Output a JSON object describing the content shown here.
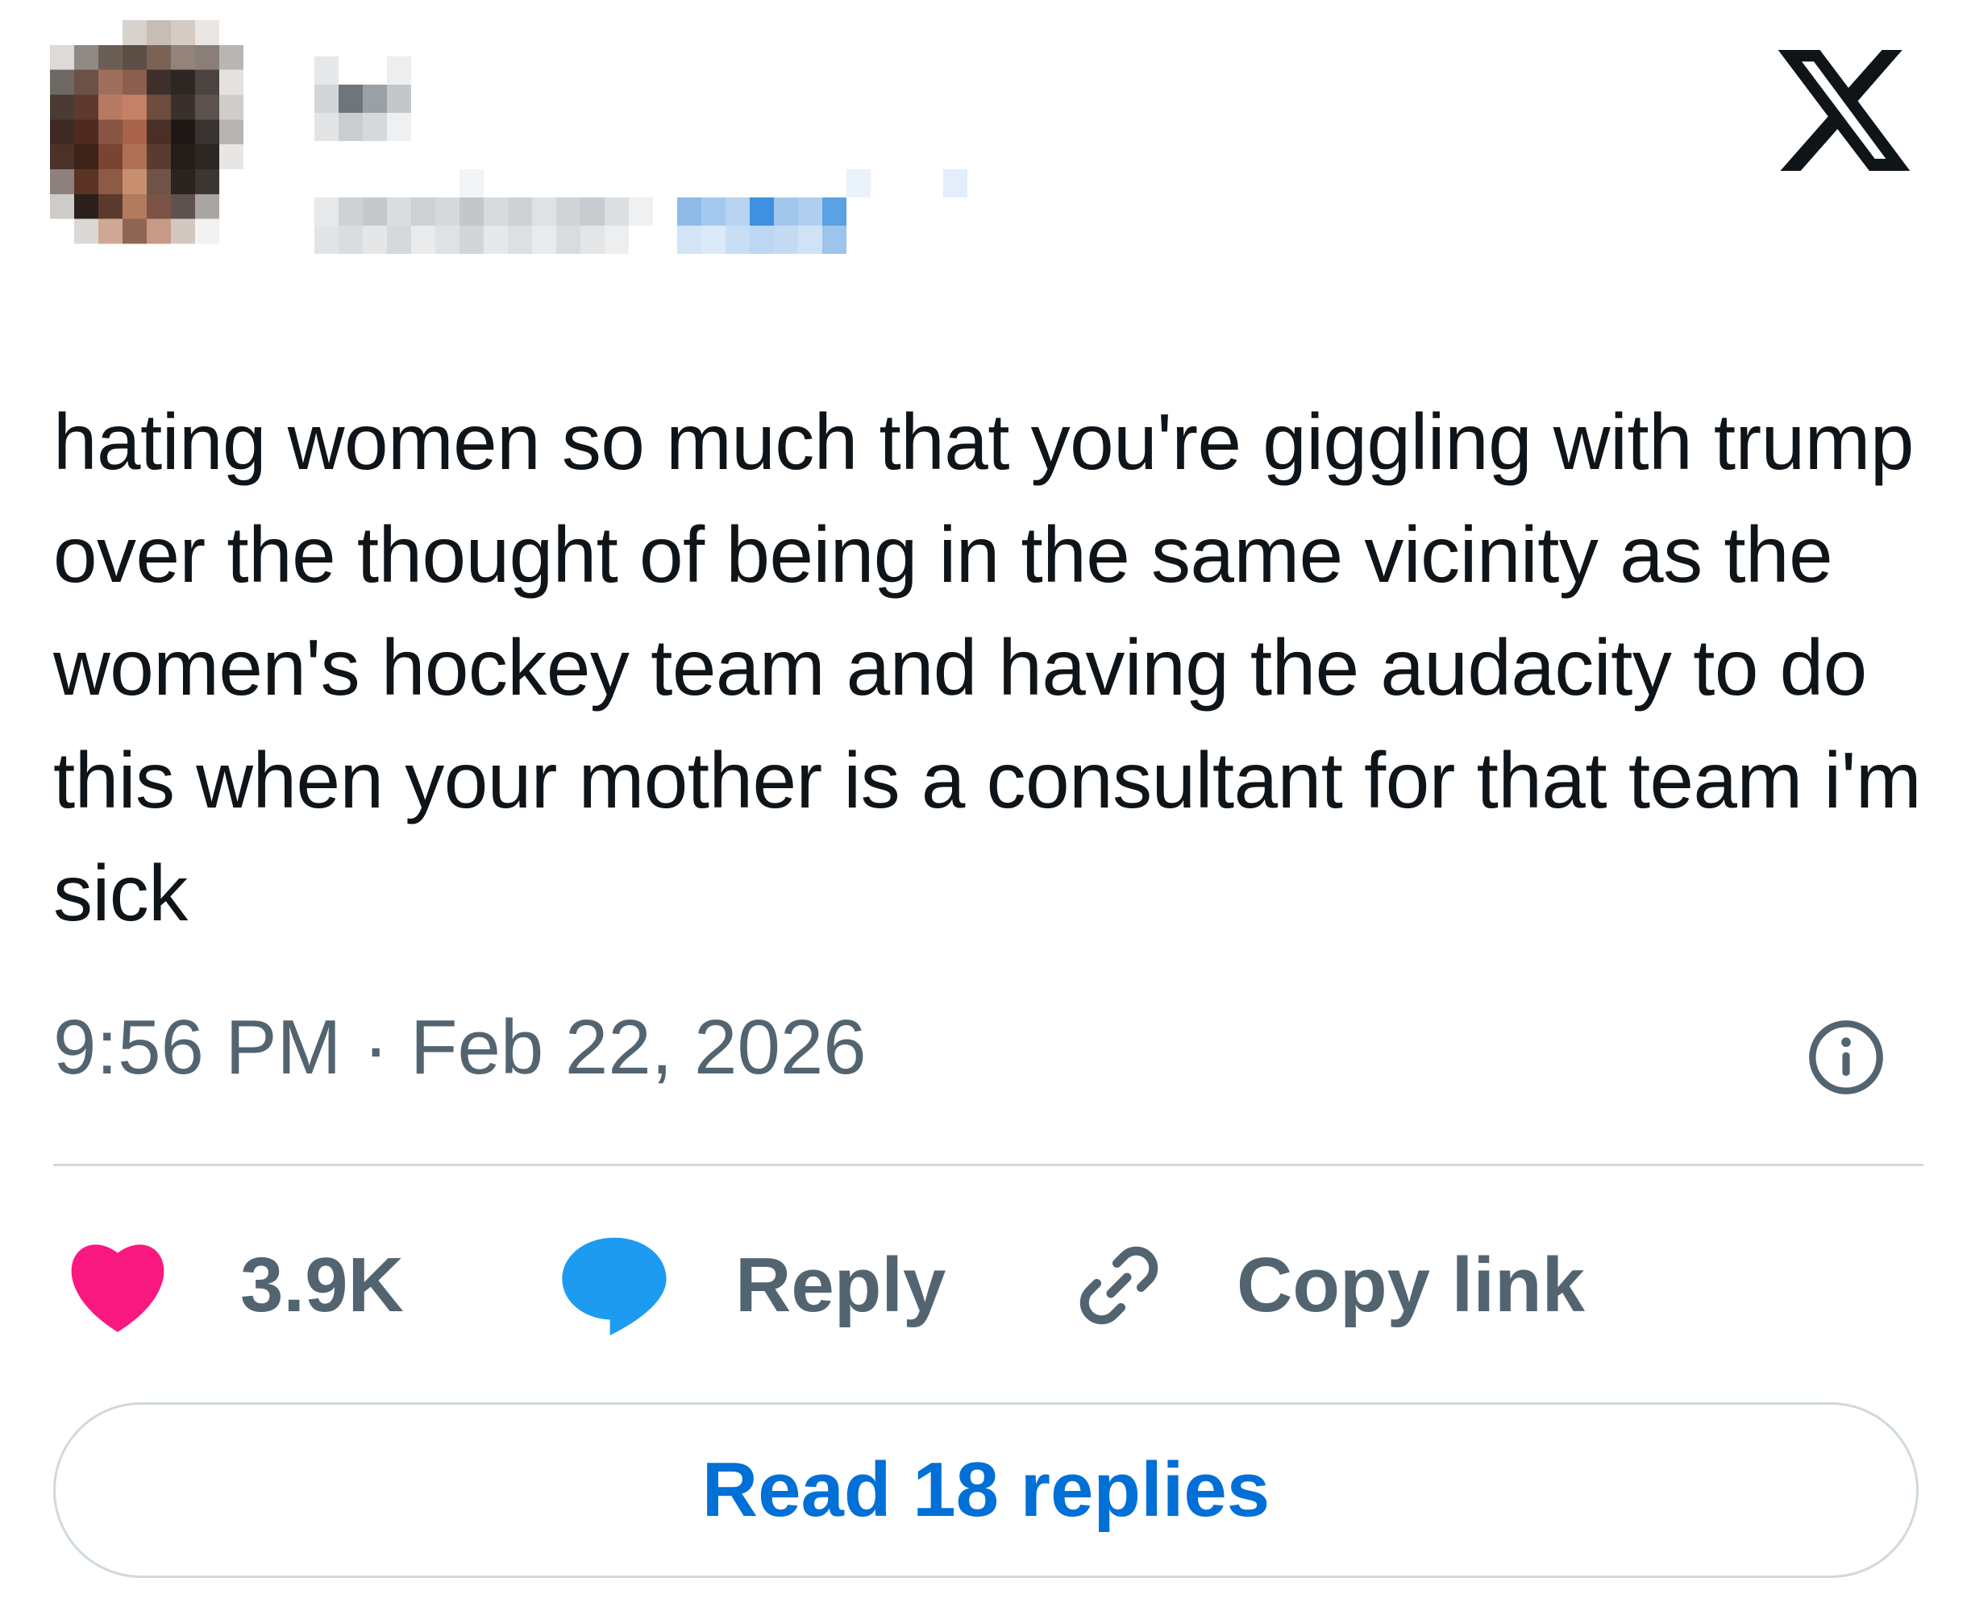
{
  "tweet": {
    "text": "hating women so much that you're giggling with trump over the thought of being in the same vicinity as the women's hockey team and having the audacity to do this when your mother is a consultant for that team i'm sick",
    "timestamp": "9:56 PM · Feb 22, 2026"
  },
  "actions": {
    "like_count": "3.9K",
    "reply_label": "Reply",
    "copy_label": "Copy link"
  },
  "read_replies_label": "Read 18 replies",
  "colors": {
    "text": "#0f1419",
    "secondary": "#536471",
    "like": "#f91880",
    "reply": "#1d9bf0",
    "link": "#006fd6",
    "border": "#cfd9de"
  },
  "icons": {
    "brand": "x-logo-icon",
    "info": "info-icon",
    "like": "heart-icon",
    "reply": "speech-bubble-icon",
    "copy": "link-icon"
  }
}
